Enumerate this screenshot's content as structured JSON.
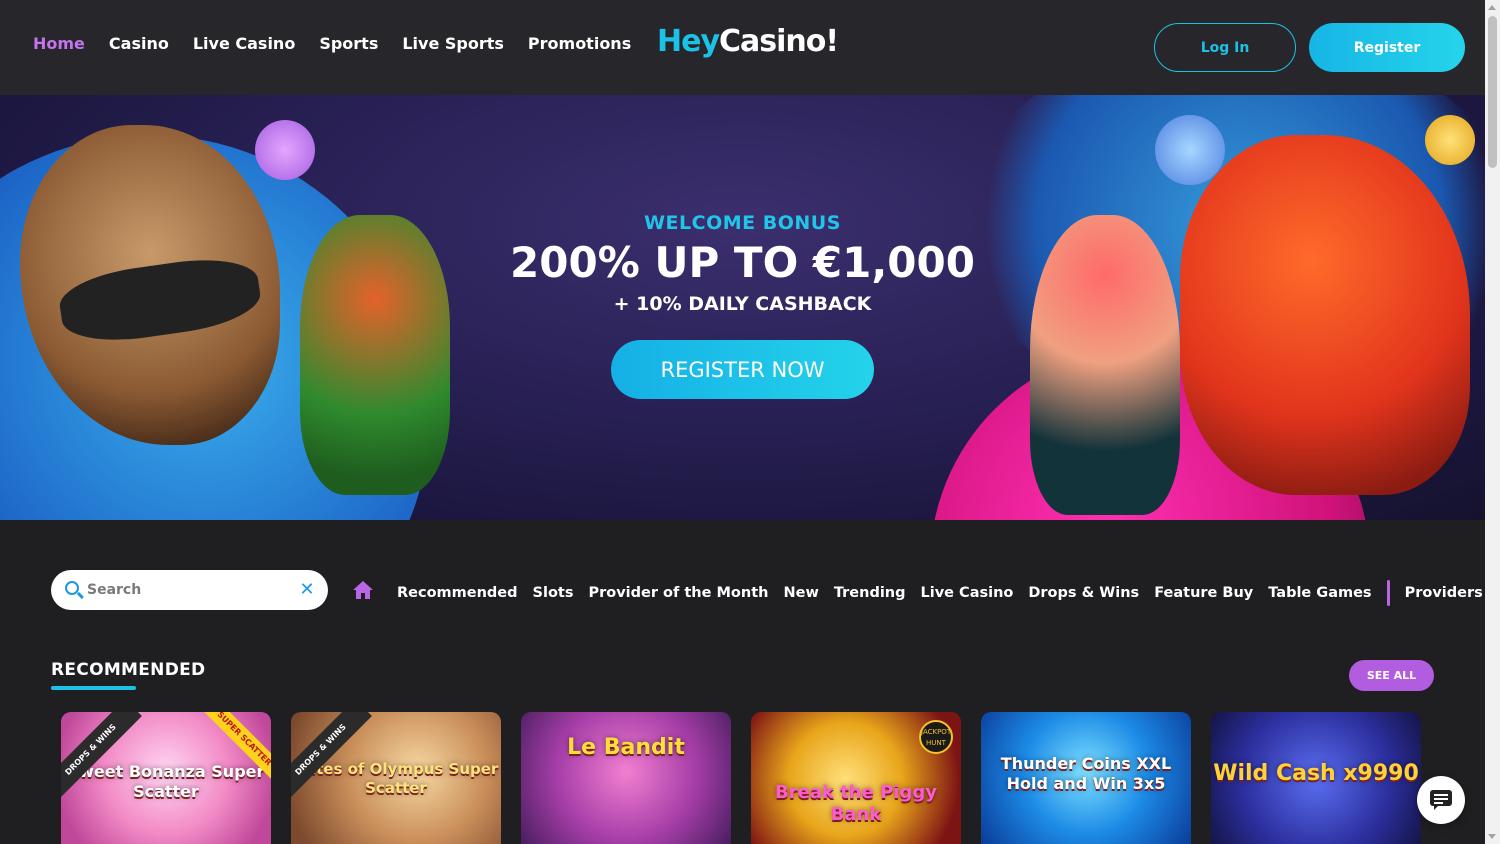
{
  "nav": {
    "items": [
      {
        "label": "Home",
        "active": true
      },
      {
        "label": "Casino",
        "active": false
      },
      {
        "label": "Live Casino",
        "active": false
      },
      {
        "label": "Sports",
        "active": false
      },
      {
        "label": "Live Sports",
        "active": false
      },
      {
        "label": "Promotions",
        "active": false
      }
    ]
  },
  "logo": {
    "hey": "Hey",
    "rest": "Casino!"
  },
  "auth": {
    "login_label": "Log In",
    "register_label": "Register"
  },
  "hero": {
    "kicker": "WELCOME BONUS",
    "title": "200% UP TO €1,000",
    "subtitle": "+ 10% DAILY CASHBACK",
    "cta_label": "REGISTER NOW"
  },
  "filters": {
    "search_placeholder": "Search",
    "categories": [
      "Recommended",
      "Slots",
      "Provider of the Month",
      "New",
      "Trending",
      "Live Casino",
      "Drops & Wins",
      "Feature Buy",
      "Table Games"
    ],
    "providers_label": "Providers"
  },
  "section": {
    "title": "RECOMMENDED",
    "see_all_label": "SEE ALL"
  },
  "games": [
    {
      "title": "Sweet Bonanza Super Scatter",
      "ribbon": "DROPS & WINS",
      "badge": "SUPER SCATTER"
    },
    {
      "title": "Gates of Olympus Super Scatter",
      "ribbon": "DROPS & WINS"
    },
    {
      "title": "Le Bandit"
    },
    {
      "title": "Break the Piggy Bank",
      "jackpot": "JACKPOT HUNT"
    },
    {
      "title": "Thunder Coins XXL Hold and Win 3x5"
    },
    {
      "title": "Wild Cash x9990"
    }
  ],
  "colors": {
    "accent": "#19c2e6",
    "purple": "#c374ee",
    "header_bg": "#27272b",
    "page_bg": "#1f1f22"
  },
  "icons": [
    "search-icon",
    "close-icon",
    "home-icon",
    "chat-icon"
  ]
}
